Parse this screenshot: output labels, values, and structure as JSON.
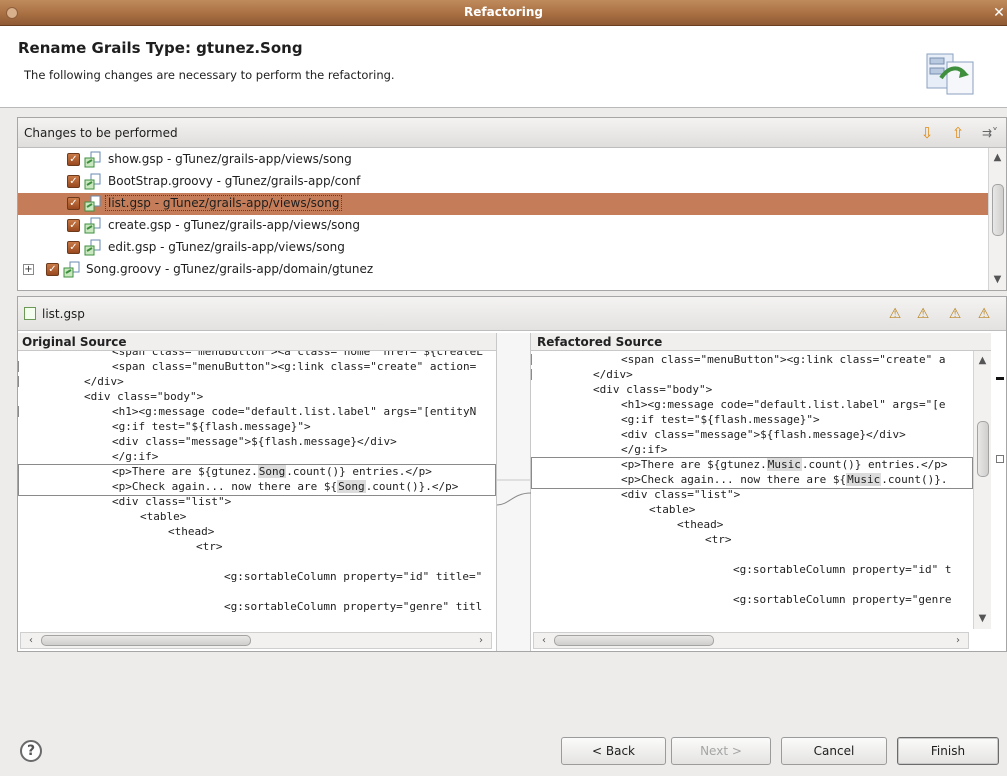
{
  "window": {
    "title": "Refactoring",
    "close": "✕"
  },
  "header": {
    "title": "Rename Grails Type: gtunez.Song",
    "subtitle": "The following changes are necessary to perform the refactoring."
  },
  "changes": {
    "label": "Changes to be performed",
    "items": [
      {
        "label": "show.gsp - gTunez/grails-app/views/song"
      },
      {
        "label": "BootStrap.groovy - gTunez/grails-app/conf"
      },
      {
        "label": "list.gsp - gTunez/grails-app/views/song"
      },
      {
        "label": "create.gsp - gTunez/grails-app/views/song"
      },
      {
        "label": "edit.gsp - gTunez/grails-app/views/song"
      },
      {
        "label": "Song.groovy - gTunez/grails-app/domain/gtunez",
        "expander": "+"
      }
    ]
  },
  "compare": {
    "file": "list.gsp",
    "left": {
      "title": "Original Source",
      "lines": [
        "<span class=\"menuButton\"><a class=\"home\" href=\"${createL",
        "<span class=\"menuButton\"><g:link class=\"create\" action=",
        "</div>",
        "<div class=\"body\">",
        "<h1><g:message code=\"default.list.label\" args=\"[entityN",
        "<g:if test=\"${flash.message}\">",
        "<div class=\"message\">${flash.message}</div>",
        "</g:if>",
        [
          "<p>There are ${gtunez.",
          "Song",
          ".count()} entries.</p>"
        ],
        [
          "<p>Check again... now there are ${",
          "Song",
          ".count()}.</p>"
        ],
        "<div class=\"list\">",
        "<table>",
        "<thead>",
        "<tr>",
        "",
        "<g:sortableColumn property=\"id\" title=\"",
        "",
        "<g:sortableColumn property=\"genre\" titl"
      ]
    },
    "right": {
      "title": "Refactored Source",
      "lines": [
        "<span class=\"menuButton\"><g:link class=\"create\" a",
        "</div>",
        "<div class=\"body\">",
        "<h1><g:message code=\"default.list.label\" args=\"[e",
        "<g:if test=\"${flash.message}\">",
        "<div class=\"message\">${flash.message}</div>",
        "</g:if>",
        [
          "<p>There are ${gtunez.",
          "Music",
          ".count()} entries.</p>"
        ],
        [
          "<p>Check again... now there are ${",
          "Music",
          ".count()}."
        ],
        "<div class=\"list\">",
        "<table>",
        "<thead>",
        "<tr>",
        "",
        "<g:sortableColumn property=\"id\" t",
        "",
        "<g:sortableColumn property=\"genre"
      ]
    }
  },
  "buttons": {
    "help": "?",
    "back": "< Back",
    "next": "Next >",
    "cancel": "Cancel",
    "finish": "Finish"
  },
  "colors": {
    "accent": "#c47d58",
    "title_bar": "#a96f43"
  }
}
